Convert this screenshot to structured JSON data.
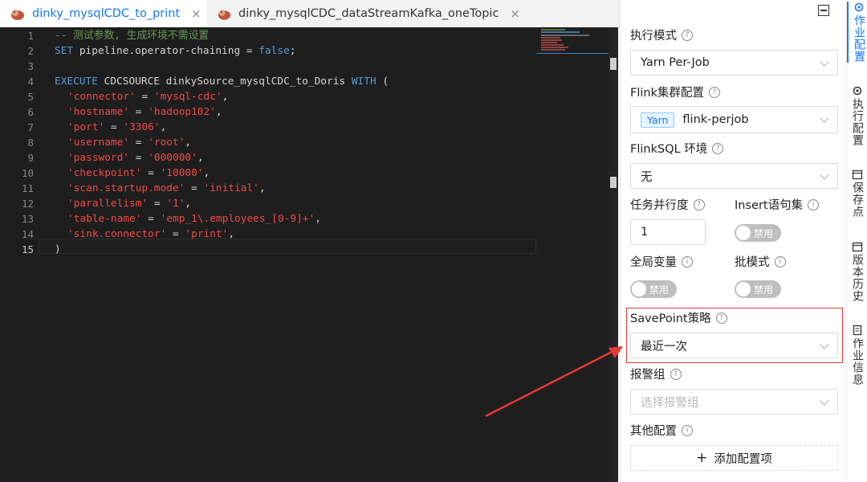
{
  "tabs": [
    {
      "label": "dinky_mysqlCDC_to_print",
      "close": "×"
    },
    {
      "label": "dinky_mysqlCDC_dataStreamKafka_oneTopic",
      "close": "×"
    }
  ],
  "editor": {
    "line_numbers": [
      "1",
      "2",
      "3",
      "4",
      "5",
      "6",
      "7",
      "8",
      "9",
      "10",
      "11",
      "12",
      "13",
      "14",
      "15"
    ],
    "lines": {
      "l1": "-- 测试参数, 生成环境不需设置",
      "l2_kw": "SET",
      "l2_rest": " pipeline.operator-chaining = ",
      "l2_val": "false",
      "l2_end": ";",
      "l4_kw1": "EXECUTE",
      "l4_mid1": " CDCSOURCE dinkySource_mysqlCDC_to_Doris ",
      "l4_kw2": "WITH",
      "l4_end": " (",
      "props": [
        {
          "k": "'connector'",
          "v": "'mysql-cdc'"
        },
        {
          "k": "'hostname'",
          "v": "'hadoop102'"
        },
        {
          "k": "'port'",
          "v": "'3306'"
        },
        {
          "k": "'username'",
          "v": "'root'"
        },
        {
          "k": "'password'",
          "v": "'000000'"
        },
        {
          "k": "'checkpoint'",
          "v": "'10000'"
        },
        {
          "k": "'scan.startup.mode'",
          "v": "'initial'"
        },
        {
          "k": "'parallelism'",
          "v": "'1'"
        },
        {
          "k": "'table-name'",
          "v": "'emp_1\\.employees_[0-9]+'"
        },
        {
          "k": "'sink.connector'",
          "v": "'print'"
        }
      ],
      "eq": " = ",
      "comma": ",",
      "l15": ")"
    }
  },
  "panel": {
    "exec_mode": {
      "label": "执行模式",
      "value": "Yarn Per-Job"
    },
    "flink_cluster": {
      "label": "Flink集群配置",
      "tag": "Yarn",
      "value": "flink-perjob"
    },
    "flinksql_env": {
      "label": "FlinkSQL 环境",
      "value": "无"
    },
    "parallelism": {
      "label": "任务并行度",
      "value": "1"
    },
    "insert_set": {
      "label": "Insert语句集",
      "switch": "禁用"
    },
    "global_var": {
      "label": "全局变量",
      "switch": "禁用"
    },
    "batch_mode": {
      "label": "批模式",
      "switch": "禁用"
    },
    "savepoint": {
      "label": "SavePoint策略",
      "value": "最近一次"
    },
    "alert_group": {
      "label": "报警组",
      "placeholder": "选择报警组"
    },
    "other_config": {
      "label": "其他配置",
      "add_button": "添加配置项"
    }
  },
  "side_tabs": [
    "作业配置",
    "执行配置",
    "保存点",
    "版本历史",
    "作业信息"
  ],
  "colors": {
    "accent": "#1677ff",
    "highlight_box": "#e53935"
  }
}
